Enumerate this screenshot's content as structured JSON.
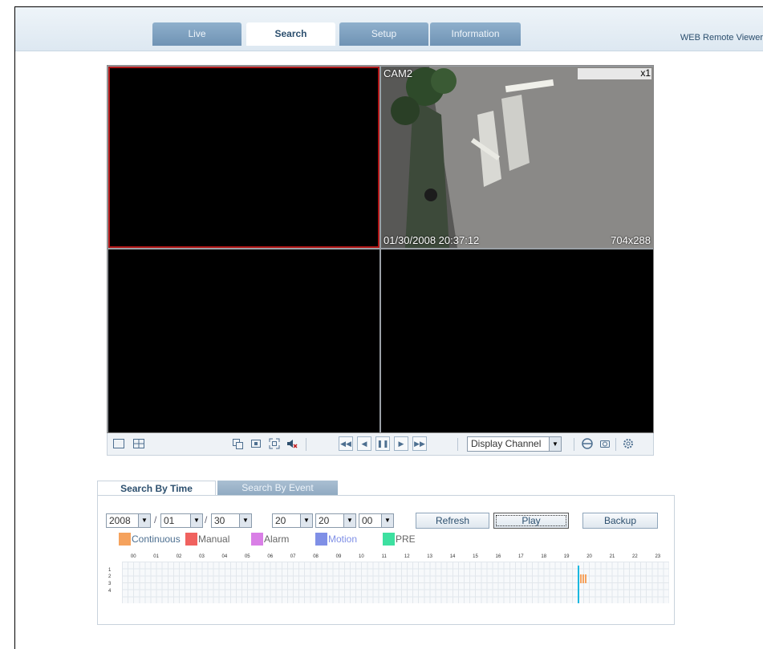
{
  "header": {
    "tabs": [
      {
        "label": "Live",
        "active": false
      },
      {
        "label": "Search",
        "active": true
      },
      {
        "label": "Setup",
        "active": false
      },
      {
        "label": "Information",
        "active": false
      }
    ],
    "brand": "WEB Remote Viewer"
  },
  "video": {
    "cam2": {
      "label": "CAM2",
      "zoom": "x1",
      "timestamp": "01/30/2008 20:37:12",
      "resolution": "704x288"
    }
  },
  "controls": {
    "display_channel": "Display Channel",
    "icons": [
      "single-view-icon",
      "quad-view-icon",
      "copy-icon",
      "fit-icon",
      "fullscreen-icon",
      "audio-mute-icon",
      "fast-rewind-icon",
      "step-back-icon",
      "pause-icon",
      "step-forward-icon",
      "fast-forward-icon",
      "print-icon",
      "snapshot-icon",
      "settings-icon"
    ]
  },
  "search": {
    "tabs": {
      "by_time": "Search By Time",
      "by_event": "Search By Event"
    },
    "year": "2008",
    "month": "01",
    "day": "30",
    "hour": "20",
    "minute": "20",
    "second": "00",
    "separator": "/",
    "buttons": {
      "refresh": "Refresh",
      "play": "Play",
      "backup": "Backup"
    },
    "legend": [
      {
        "label": "Continuous",
        "color": "#f5a25d"
      },
      {
        "label": "Manual",
        "color": "#f0625f"
      },
      {
        "label": "Alarm",
        "color": "#d97fe6"
      },
      {
        "label": "Motion",
        "color": "#7f8fe6"
      },
      {
        "label": "PRE",
        "color": "#3de0a0"
      }
    ],
    "timeline": {
      "hours": [
        "00",
        "01",
        "02",
        "03",
        "04",
        "05",
        "06",
        "07",
        "08",
        "09",
        "10",
        "11",
        "12",
        "13",
        "14",
        "15",
        "16",
        "17",
        "18",
        "19",
        "20",
        "21",
        "22",
        "23"
      ],
      "channels": [
        "1",
        "2",
        "3",
        "4"
      ],
      "cursor_color": "#1ab8e0",
      "recordings": [
        {
          "channel": 2,
          "start_hour": 20.1,
          "end_hour": 20.4,
          "type": "Continuous"
        }
      ],
      "cursor_hour": 20.0
    }
  }
}
